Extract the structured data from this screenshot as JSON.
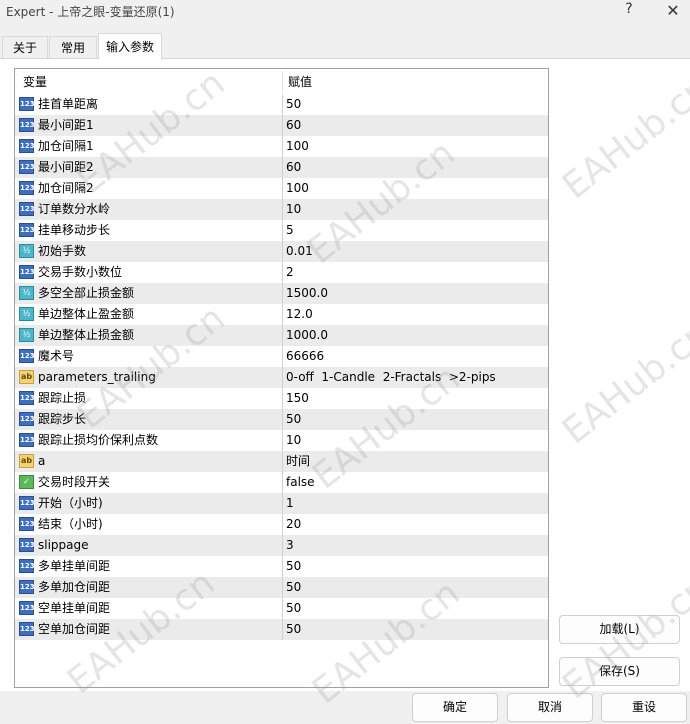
{
  "window": {
    "title": "Expert - 上帝之眼-变量还原(1)",
    "help_label": "?",
    "close_label": "✕"
  },
  "tabs": [
    {
      "label": "关于"
    },
    {
      "label": "常用"
    },
    {
      "label": "输入参数"
    }
  ],
  "grid": {
    "col_variable": "变量",
    "col_value": "赋值",
    "rows": [
      {
        "type": "int",
        "icon": "123",
        "name": "挂首单距离",
        "value": "50"
      },
      {
        "type": "int",
        "icon": "123",
        "name": "最小间距1",
        "value": "60"
      },
      {
        "type": "int",
        "icon": "123",
        "name": "加仓间隔1",
        "value": "100"
      },
      {
        "type": "int",
        "icon": "123",
        "name": "最小间距2",
        "value": "60"
      },
      {
        "type": "int",
        "icon": "123",
        "name": "加仓间隔2",
        "value": "100"
      },
      {
        "type": "int",
        "icon": "123",
        "name": "订单数分水岭",
        "value": "10"
      },
      {
        "type": "int",
        "icon": "123",
        "name": "挂单移动步长",
        "value": "5"
      },
      {
        "type": "dbl",
        "icon": "½",
        "name": "初始手数",
        "value": "0.01"
      },
      {
        "type": "int",
        "icon": "123",
        "name": "交易手数小数位",
        "value": "2"
      },
      {
        "type": "dbl",
        "icon": "½",
        "name": "多空全部止损金额",
        "value": "1500.0"
      },
      {
        "type": "dbl",
        "icon": "½",
        "name": "单边整体止盈金额",
        "value": "12.0"
      },
      {
        "type": "dbl",
        "icon": "½",
        "name": "单边整体止损金额",
        "value": "1000.0"
      },
      {
        "type": "int",
        "icon": "123",
        "name": "魔术号",
        "value": "66666"
      },
      {
        "type": "str",
        "icon": "ab",
        "name": "parameters_trailing",
        "value": "0-off  1-Candle  2-Fractals  >2-pips"
      },
      {
        "type": "int",
        "icon": "123",
        "name": "跟踪止损",
        "value": "150"
      },
      {
        "type": "int",
        "icon": "123",
        "name": "跟踪步长",
        "value": "50"
      },
      {
        "type": "int",
        "icon": "123",
        "name": "跟踪止损均价保利点数",
        "value": "10"
      },
      {
        "type": "str",
        "icon": "ab",
        "name": "a",
        "value": "时间"
      },
      {
        "type": "bool",
        "icon": "✓",
        "name": "交易时段开关",
        "value": "false"
      },
      {
        "type": "int",
        "icon": "123",
        "name": "开始（小时)",
        "value": "1"
      },
      {
        "type": "int",
        "icon": "123",
        "name": "结束（小时)",
        "value": "20"
      },
      {
        "type": "int",
        "icon": "123",
        "name": "slippage",
        "value": "3"
      },
      {
        "type": "int",
        "icon": "123",
        "name": "多单挂单间距",
        "value": "50"
      },
      {
        "type": "int",
        "icon": "123",
        "name": "多单加仓间距",
        "value": "50"
      },
      {
        "type": "int",
        "icon": "123",
        "name": "空单挂单间距",
        "value": "50"
      },
      {
        "type": "int",
        "icon": "123",
        "name": "空单加仓间距",
        "value": "50"
      }
    ]
  },
  "buttons": {
    "load": "加载(L)",
    "save": "保存(S)",
    "ok": "确定",
    "cancel": "取消",
    "reset": "重设"
  },
  "watermark": "EAHub.cn"
}
